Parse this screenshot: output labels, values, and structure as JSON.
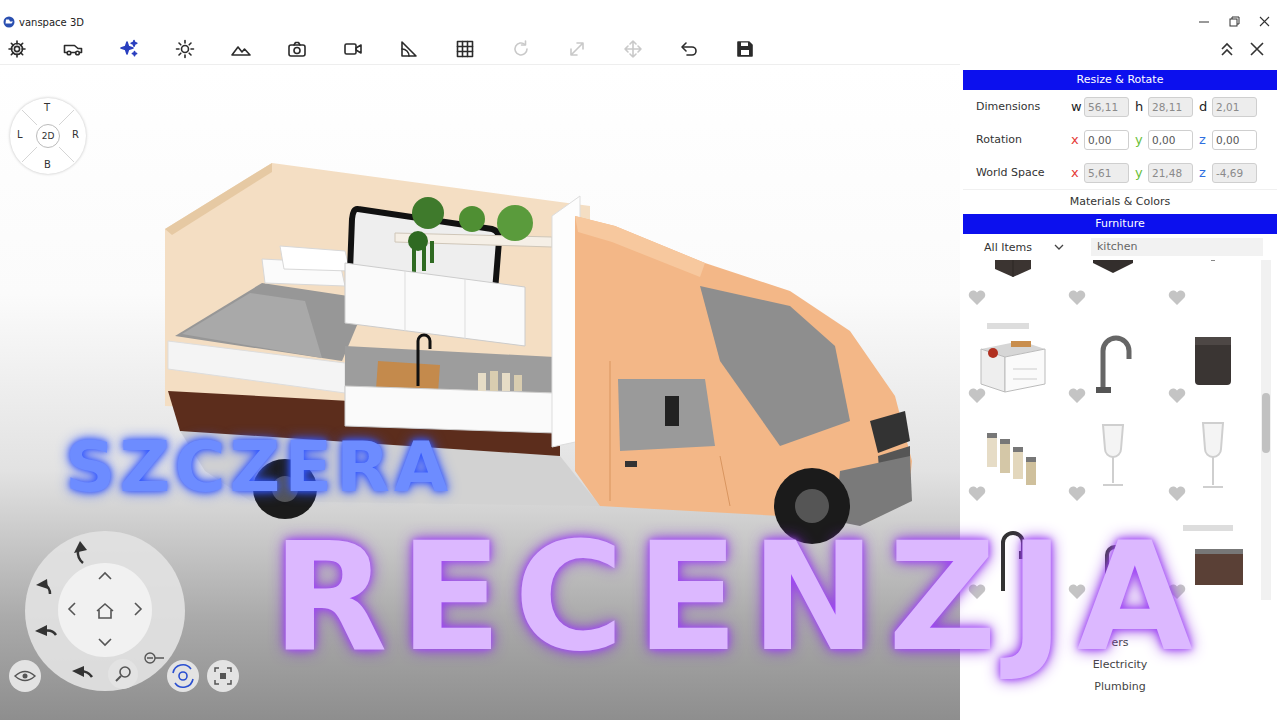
{
  "window": {
    "title": "vanspace 3D"
  },
  "toolbar": {
    "tools": [
      {
        "disabled": false
      },
      {
        "disabled": false
      },
      {
        "disabled": false
      },
      {
        "disabled": false
      },
      {
        "disabled": false
      },
      {
        "disabled": false
      },
      {
        "disabled": false
      },
      {
        "disabled": false
      },
      {
        "disabled": false
      },
      {
        "disabled": true
      },
      {
        "disabled": true
      },
      {
        "disabled": true
      },
      {
        "disabled": false
      },
      {
        "disabled": false
      }
    ]
  },
  "nav_cube": {
    "top": "T",
    "left": "L",
    "center": "2D",
    "right": "R",
    "bottom": "B"
  },
  "resize_rotate": {
    "title": "Resize & Rotate",
    "rows": [
      {
        "label": "Dimensions",
        "disabled": true,
        "fields": [
          {
            "axis": "w",
            "value": "56,11",
            "color": "#222222"
          },
          {
            "axis": "h",
            "value": "28,11",
            "color": "#222222"
          },
          {
            "axis": "d",
            "value": "2,01",
            "color": "#222222"
          }
        ]
      },
      {
        "label": "Rotation",
        "disabled": false,
        "fields": [
          {
            "axis": "x",
            "value": "0,00",
            "color": "#e53935"
          },
          {
            "axis": "y",
            "value": "0,00",
            "color": "#6abf3a"
          },
          {
            "axis": "z",
            "value": "0,00",
            "color": "#2f6fe0"
          }
        ]
      },
      {
        "label": "World Space",
        "disabled": true,
        "fields": [
          {
            "axis": "x",
            "value": "5,61",
            "color": "#e53935"
          },
          {
            "axis": "y",
            "value": "21,48",
            "color": "#6abf3a"
          },
          {
            "axis": "z",
            "value": "-4,69",
            "color": "#2f6fe0"
          }
        ]
      }
    ]
  },
  "materials": {
    "label": "Materials & Colors"
  },
  "furniture": {
    "title": "Furniture",
    "filter": {
      "value": "All Items"
    },
    "search": {
      "value": "kitchen"
    },
    "items": [
      {
        "favorite": false
      },
      {
        "favorite": false
      },
      {
        "favorite": false
      },
      {
        "favorite": false
      },
      {
        "favorite": false
      },
      {
        "favorite": false
      },
      {
        "favorite": false
      },
      {
        "favorite": false
      },
      {
        "favorite": false
      },
      {
        "favorite": false
      },
      {
        "favorite": false
      },
      {
        "favorite": false
      }
    ]
  },
  "categories": [
    {
      "label": "ery"
    },
    {
      "label": "ers"
    },
    {
      "label": "Electricity"
    },
    {
      "label": "Plumbing"
    }
  ],
  "overlay": {
    "line1": "SZCZERA",
    "line2": "RECENZJA"
  }
}
